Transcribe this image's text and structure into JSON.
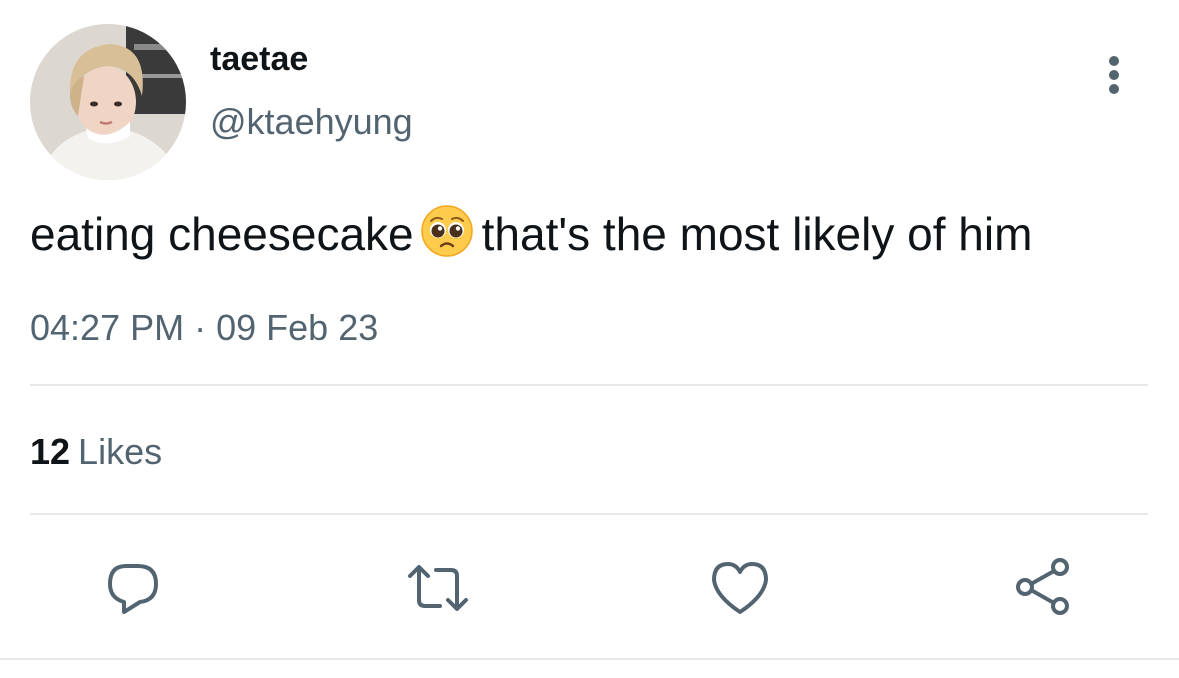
{
  "author": {
    "display_name": "taetae",
    "handle": "@ktaehyung",
    "avatar_icon": "profile-photo"
  },
  "tweet": {
    "text_before_emoji": "eating cheesecake",
    "emoji": "pleading-face-emoji",
    "text_after_emoji": "that's the most likely of him",
    "time": "04:27 PM",
    "separator": "·",
    "date": "09 Feb 23"
  },
  "stats": {
    "likes_count": "12",
    "likes_label": "Likes"
  },
  "actions": {
    "reply_icon": "reply-icon",
    "retweet_icon": "retweet-icon",
    "like_icon": "heart-icon",
    "share_icon": "share-icon",
    "more_icon": "more-options-icon"
  },
  "colors": {
    "text": "#0f1419",
    "secondary": "#536471",
    "divider": "#e6e9eb"
  }
}
